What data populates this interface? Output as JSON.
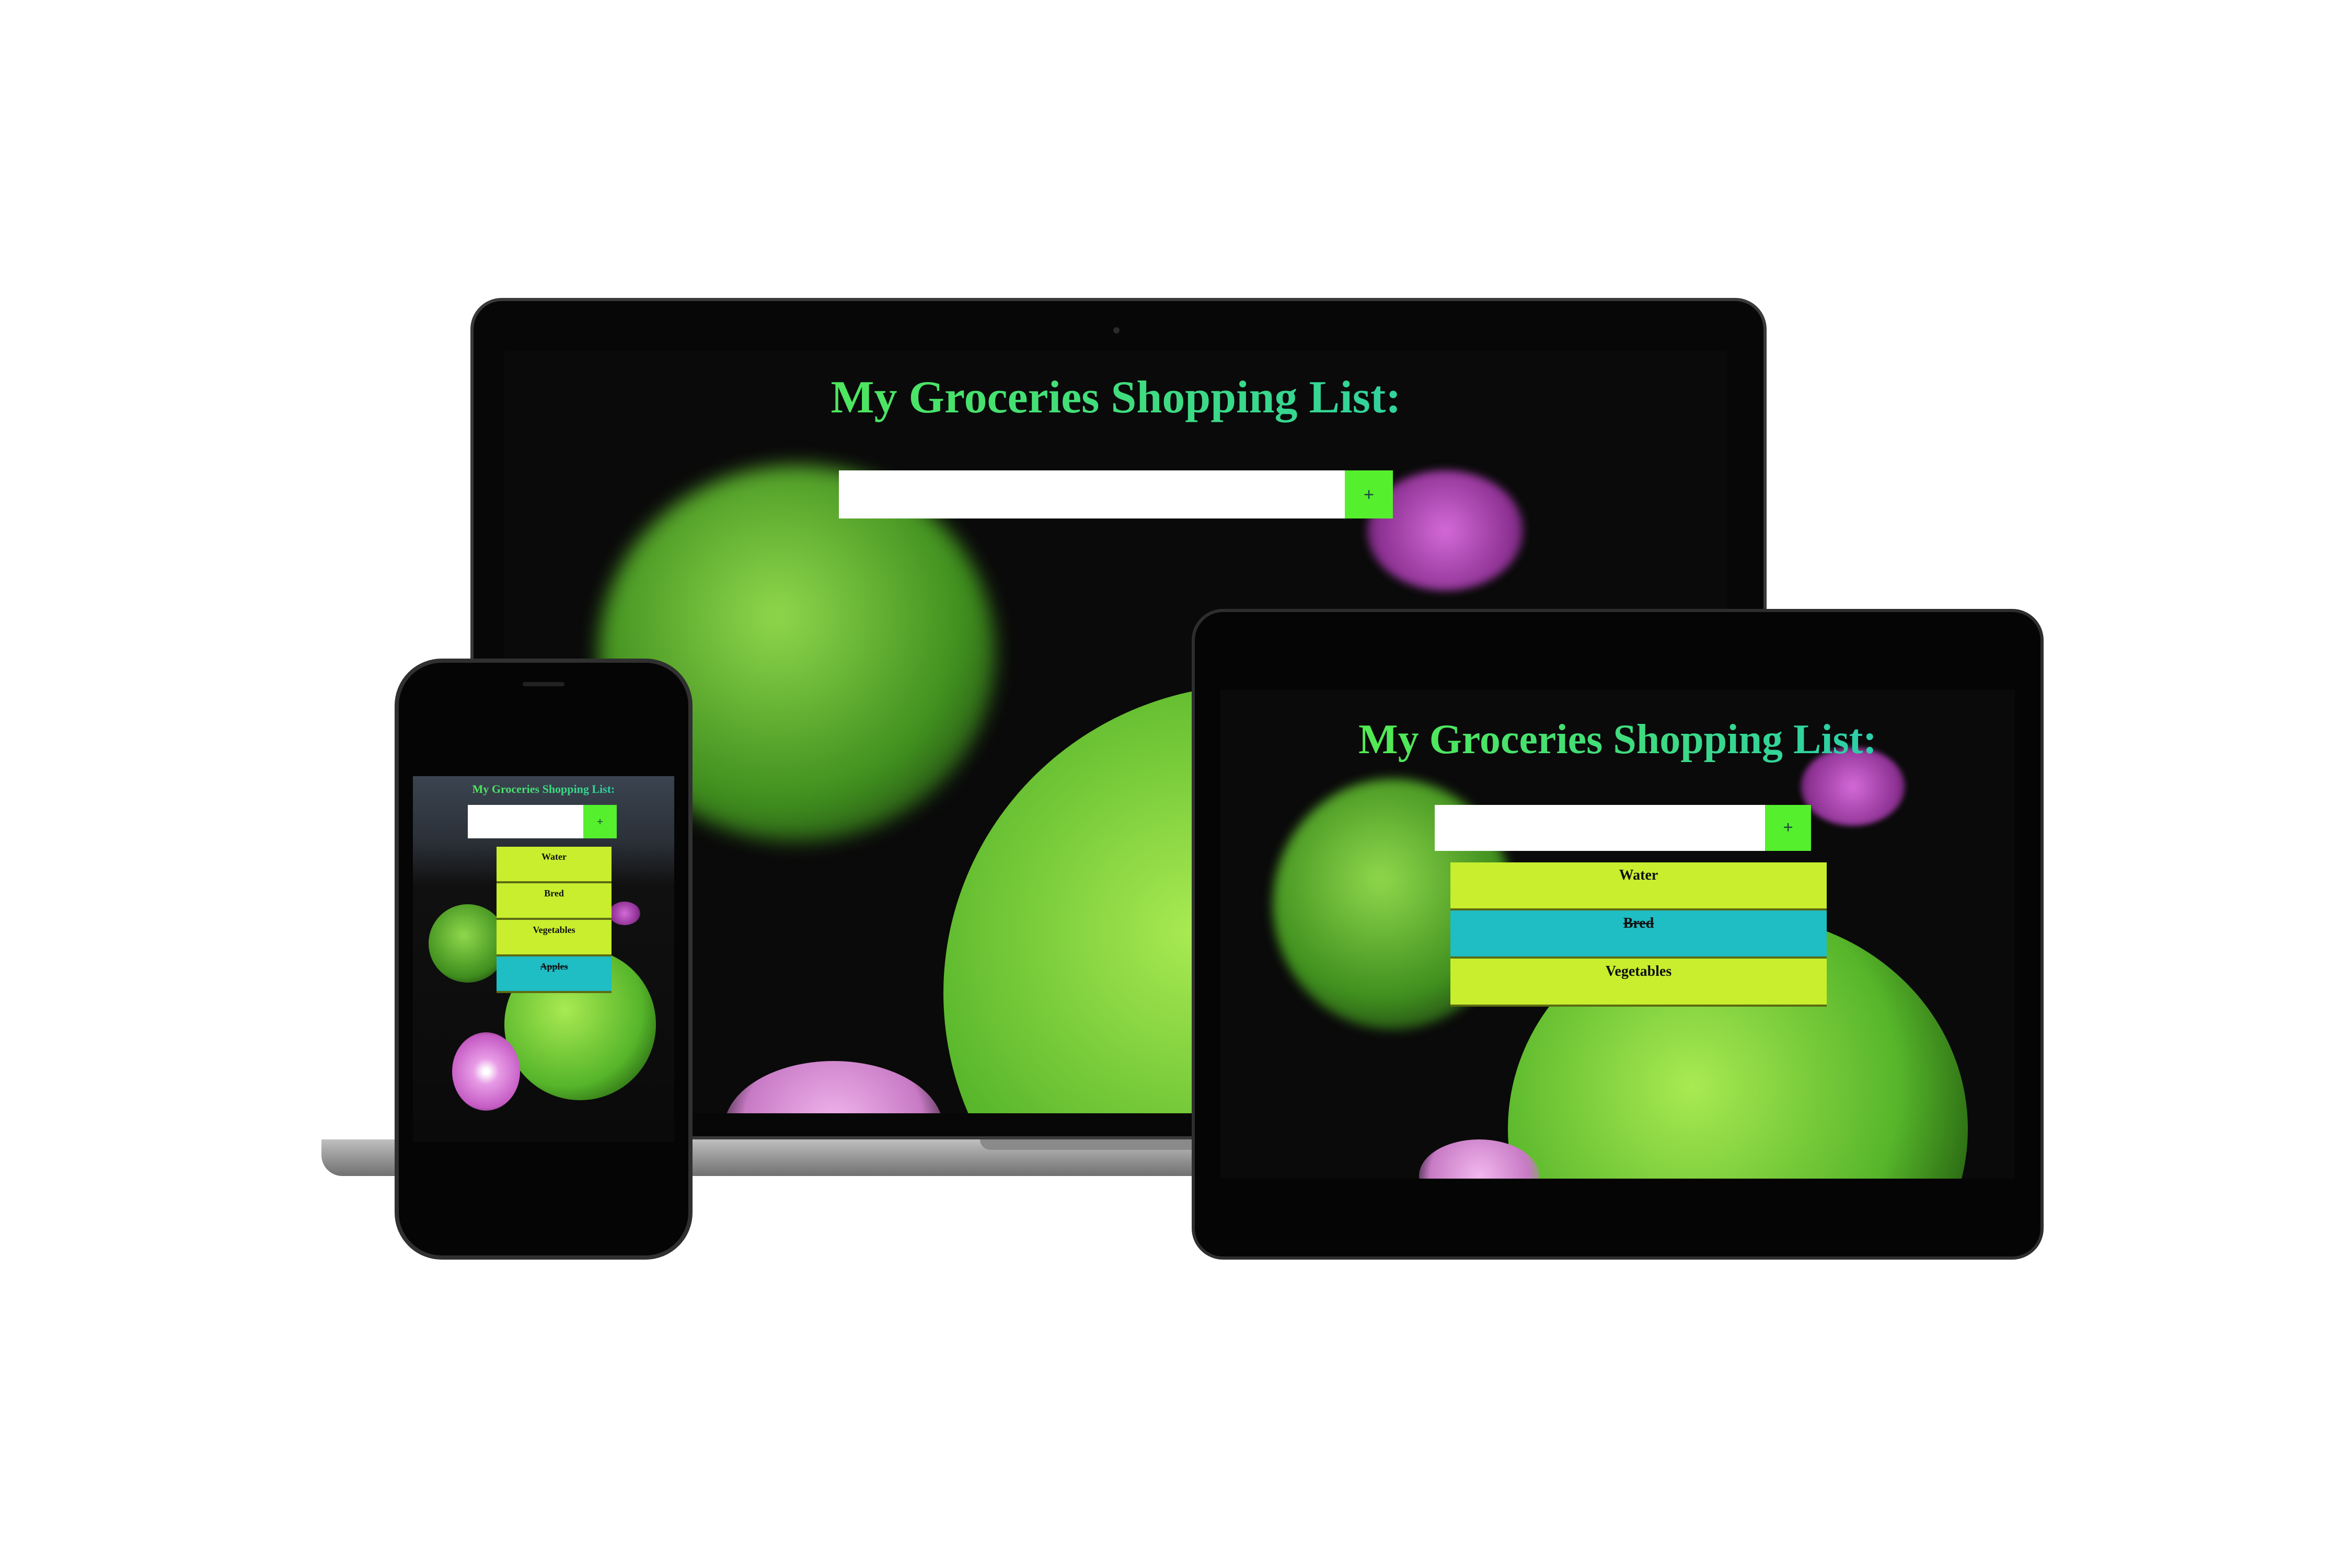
{
  "app": {
    "title": "My Groceries Shopping List:",
    "input_value": "",
    "add_label": "+",
    "colors": {
      "accent": "#55ef2e",
      "item_todo": "#c8ee2e",
      "item_done": "#1fbdc4",
      "title_start": "#5ef23a",
      "title_end": "#1fc6c4"
    }
  },
  "laptop": {
    "items": []
  },
  "tablet": {
    "items": [
      {
        "label": "Water",
        "done": false
      },
      {
        "label": "Bred",
        "done": true
      },
      {
        "label": "Vegetables",
        "done": false
      }
    ]
  },
  "phone": {
    "items": [
      {
        "label": "Water",
        "done": false
      },
      {
        "label": "Bred",
        "done": false
      },
      {
        "label": "Vegetables",
        "done": false
      },
      {
        "label": "Apples",
        "done": true
      }
    ]
  }
}
